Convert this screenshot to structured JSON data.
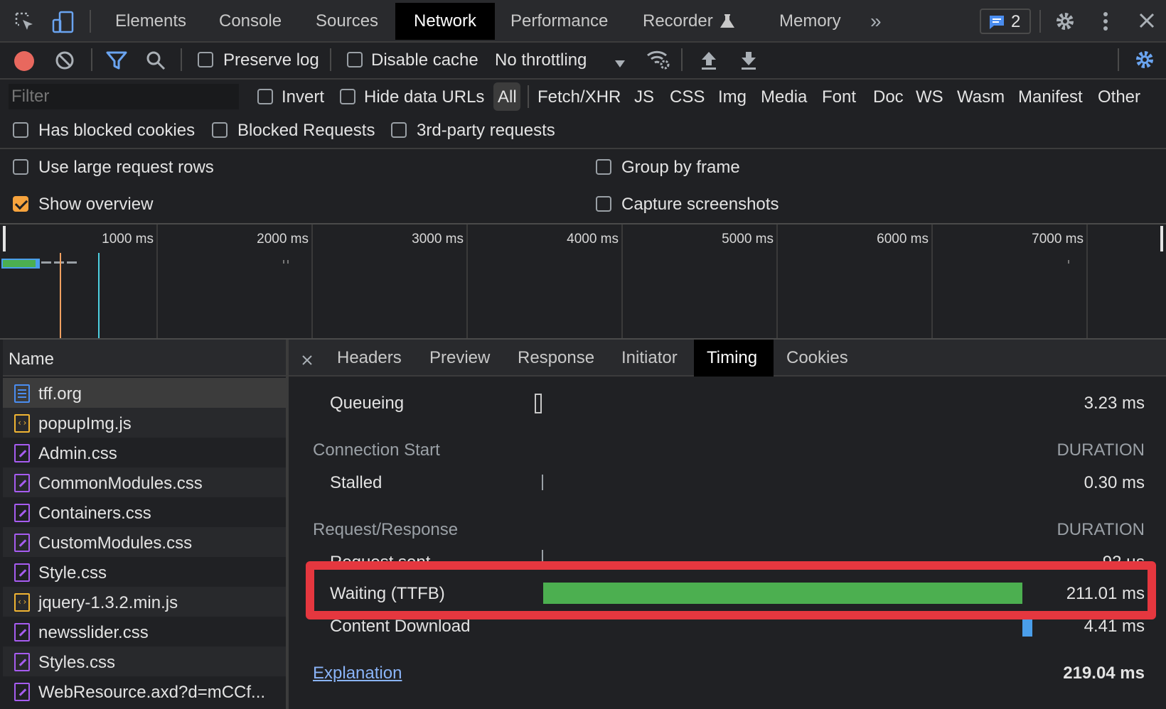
{
  "toolbar": {
    "tabs": [
      "Elements",
      "Console",
      "Sources",
      "Network",
      "Performance",
      "Recorder",
      "Memory"
    ],
    "issues_count": "2"
  },
  "network_toolbar": {
    "preserve_log": "Preserve log",
    "disable_cache": "Disable cache",
    "throttling": "No throttling"
  },
  "filter_bar": {
    "placeholder": "Filter",
    "invert": "Invert",
    "hide_data_urls": "Hide data URLs",
    "types": [
      "All",
      "Fetch/XHR",
      "JS",
      "CSS",
      "Img",
      "Media",
      "Font",
      "Doc",
      "WS",
      "Wasm",
      "Manifest",
      "Other"
    ],
    "has_blocked_cookies": "Has blocked cookies",
    "blocked_requests": "Blocked Requests",
    "third_party": "3rd-party requests"
  },
  "settings": {
    "large_rows": "Use large request rows",
    "show_overview": "Show overview",
    "group_by_frame": "Group by frame",
    "capture_screenshots": "Capture screenshots"
  },
  "overview": {
    "ticks": [
      "1000 ms",
      "2000 ms",
      "3000 ms",
      "4000 ms",
      "5000 ms",
      "6000 ms",
      "7000 ms"
    ]
  },
  "requests": {
    "header": "Name",
    "items": [
      {
        "name": "tff.org",
        "type": "doc"
      },
      {
        "name": "popupImg.js",
        "type": "js"
      },
      {
        "name": "Admin.css",
        "type": "css"
      },
      {
        "name": "CommonModules.css",
        "type": "css"
      },
      {
        "name": "Containers.css",
        "type": "css"
      },
      {
        "name": "CustomModules.css",
        "type": "css"
      },
      {
        "name": "Style.css",
        "type": "css"
      },
      {
        "name": "jquery-1.3.2.min.js",
        "type": "js"
      },
      {
        "name": "newsslider.css",
        "type": "css"
      },
      {
        "name": "Styles.css",
        "type": "css"
      },
      {
        "name": "WebResource.axd?d=mCCf...",
        "type": "css"
      }
    ]
  },
  "detail": {
    "tabs": [
      "Headers",
      "Preview",
      "Response",
      "Initiator",
      "Timing",
      "Cookies"
    ],
    "queueing_label": "Queueing",
    "queueing_value": "3.23 ms",
    "connection_start": "Connection Start",
    "duration_label": "DURATION",
    "stalled_label": "Stalled",
    "stalled_value": "0.30 ms",
    "request_response": "Request/Response",
    "request_sent_label": "Request sent",
    "request_sent_value": "92 µs",
    "ttfb_label": "Waiting (TTFB)",
    "ttfb_value": "211.01 ms",
    "content_download_label": "Content Download",
    "content_download_value": "4.41 ms",
    "explanation": "Explanation",
    "total": "219.04 ms"
  },
  "colors": {
    "accent_orange": "#f6a33d",
    "ttfb_green": "#4caf50",
    "download_blue": "#4a9eea",
    "highlight_red": "#e5373f",
    "doc_icon": "#4a8df0",
    "js_icon": "#f0b433",
    "css_icon": "#a65cf0"
  }
}
